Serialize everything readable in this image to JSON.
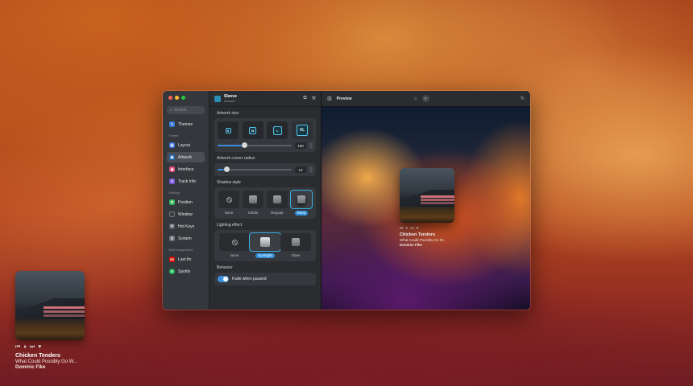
{
  "now_playing": {
    "title": "Chicken Tenders",
    "album": "What Could Possibly Go W...",
    "artist": "Dominic Fike",
    "controls": [
      "⏮",
      "⏸",
      "⏭",
      "♥"
    ]
  },
  "sidebar": {
    "search_placeholder": "Search",
    "top_item": "Themes",
    "sections": {
      "theme": "Theme",
      "settings": "Settings",
      "integrations": "Web Integrations"
    },
    "theme_items": [
      "Layout",
      "Artwork",
      "Interface",
      "Track Info"
    ],
    "settings_items": [
      "Position",
      "Window",
      "Hot Keys",
      "System"
    ],
    "integration_items": [
      "Last.fm",
      "Spotify"
    ]
  },
  "settings_panel": {
    "title": "Sleeve",
    "subtitle": "Artwork",
    "artwork_size": {
      "label": "Artwork size",
      "options": [
        "S",
        "M",
        "L",
        "XL"
      ],
      "selected": "XL",
      "value": "180",
      "slider_fraction": 0.36
    },
    "corner_radius": {
      "label": "Artwork corner radius",
      "value": "10",
      "slider_fraction": 0.12
    },
    "shadow_style": {
      "label": "Shadow style",
      "options": [
        "None",
        "Subtle",
        "Regular",
        "Deep"
      ],
      "selected": "Deep"
    },
    "lighting_effect": {
      "label": "Lighting effect",
      "options": [
        "None",
        "Spotlight",
        "Glare"
      ],
      "selected": "Spotlight"
    },
    "behavior": {
      "label": "Behavior",
      "toggle_label": "Fade when paused",
      "enabled": true
    }
  },
  "preview": {
    "title": "Preview"
  },
  "colors": {
    "accent": "#3e8ede",
    "selection_outline": "#3aaee0"
  }
}
